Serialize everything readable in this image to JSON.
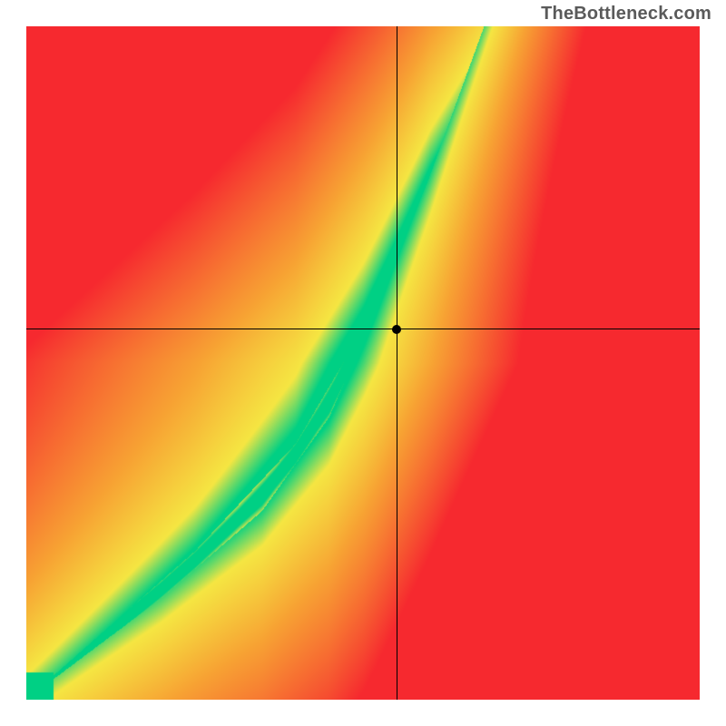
{
  "watermark": "TheBottleneck.com",
  "chart_data": {
    "type": "heatmap",
    "title": "",
    "xlabel": "",
    "ylabel": "",
    "xlim": [
      0,
      100
    ],
    "ylim": [
      0,
      100
    ],
    "grid": false,
    "crosshair": {
      "x": 55,
      "y": 55
    },
    "marker": {
      "x": 55,
      "y": 55
    },
    "optimal_band": {
      "description": "Green optimal region running diagonally from bottom-left to top-right with an S-curve bulge",
      "points_lower": [
        {
          "x": 0,
          "y": 0
        },
        {
          "x": 20,
          "y": 15
        },
        {
          "x": 35,
          "y": 28
        },
        {
          "x": 45,
          "y": 42
        },
        {
          "x": 52,
          "y": 58
        },
        {
          "x": 60,
          "y": 78
        },
        {
          "x": 68,
          "y": 100
        }
      ],
      "points_upper": [
        {
          "x": 0,
          "y": 0
        },
        {
          "x": 25,
          "y": 22
        },
        {
          "x": 40,
          "y": 38
        },
        {
          "x": 50,
          "y": 55
        },
        {
          "x": 60,
          "y": 78
        },
        {
          "x": 72,
          "y": 100
        },
        {
          "x": 80,
          "y": 100
        }
      ]
    },
    "color_scale": {
      "optimal": "#00d084",
      "near": "#f5e642",
      "mid": "#f7a233",
      "far": "#f6292f"
    }
  }
}
